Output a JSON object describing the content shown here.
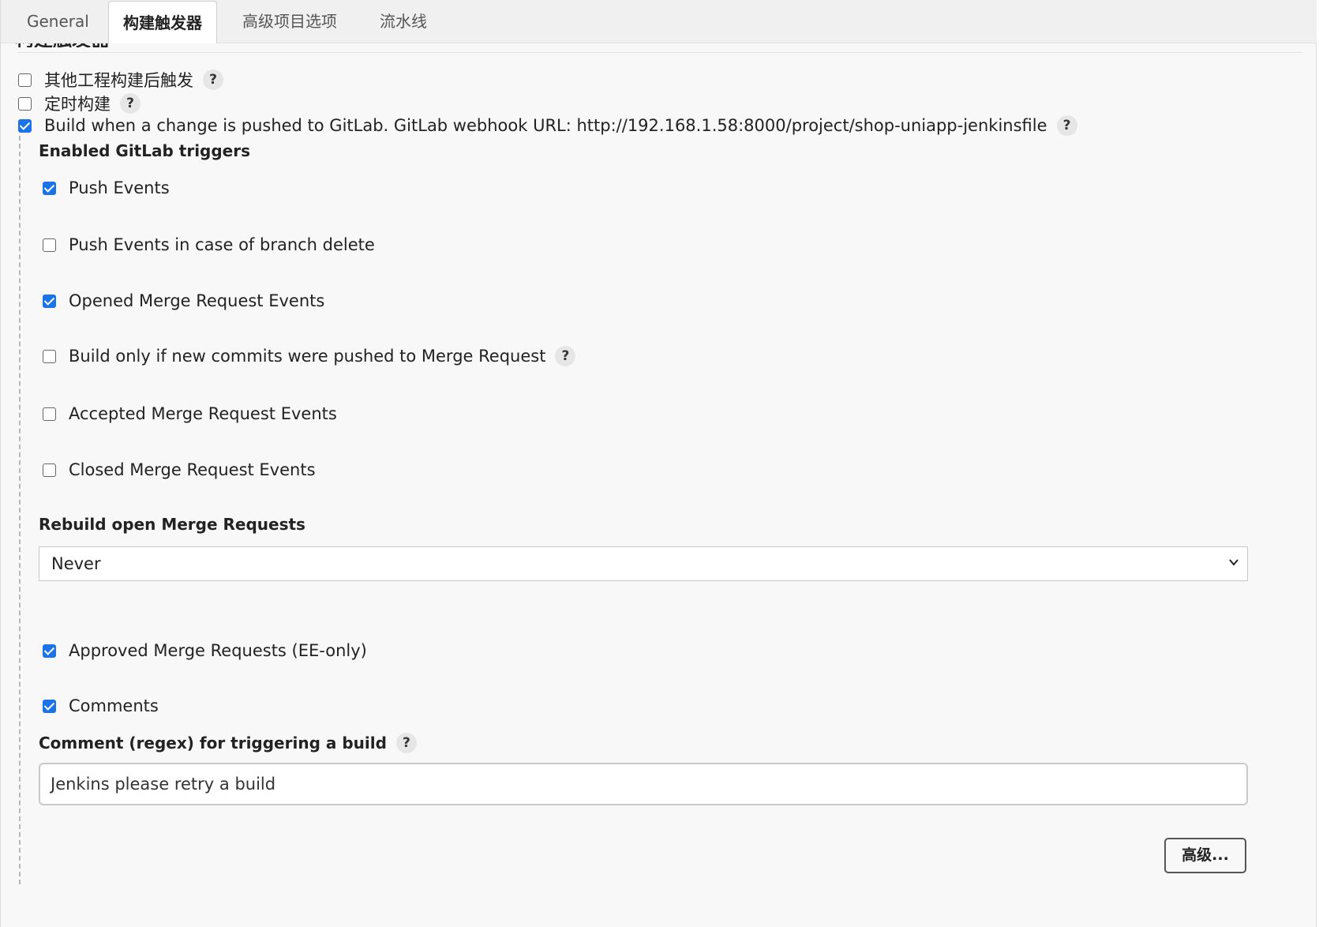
{
  "tabs": {
    "general": "General",
    "build_triggers": "构建触发器",
    "advanced_options": "高级项目选项",
    "pipeline": "流水线"
  },
  "section_heading": "构建触发器",
  "triggers": {
    "other_project": {
      "label": "其他工程构建后触发",
      "checked": false
    },
    "scheduled": {
      "label": "定时构建",
      "checked": false
    },
    "gitlab_push": {
      "label": "Build when a change is pushed to GitLab. GitLab webhook URL: http://192.168.1.58:8000/project/shop-uniapp-jenkinsfile",
      "checked": true
    }
  },
  "gitlab": {
    "enabled_title": "Enabled GitLab triggers",
    "push_events": {
      "label": "Push Events",
      "checked": true
    },
    "push_branch_delete": {
      "label": "Push Events in case of branch delete",
      "checked": false
    },
    "opened_mr": {
      "label": "Opened Merge Request Events",
      "checked": true
    },
    "build_only_new_commits": {
      "label": "Build only if new commits were pushed to Merge Request",
      "checked": false
    },
    "accepted_mr": {
      "label": "Accepted Merge Request Events",
      "checked": false
    },
    "closed_mr": {
      "label": "Closed Merge Request Events",
      "checked": false
    },
    "rebuild_title": "Rebuild open Merge Requests",
    "rebuild_value": "Never",
    "approved_mr": {
      "label": "Approved Merge Requests (EE-only)",
      "checked": true
    },
    "comments": {
      "label": "Comments",
      "checked": true
    },
    "comment_regex_title": "Comment (regex) for triggering a build",
    "comment_regex_value": "Jenkins please retry a build",
    "advanced_button": "高级..."
  },
  "help_glyph": "?",
  "colors": {
    "checkbox_checked": "#1a73e8",
    "panel_bg": "#f8f8f8",
    "tabbar_bg": "#f0f0f0"
  }
}
